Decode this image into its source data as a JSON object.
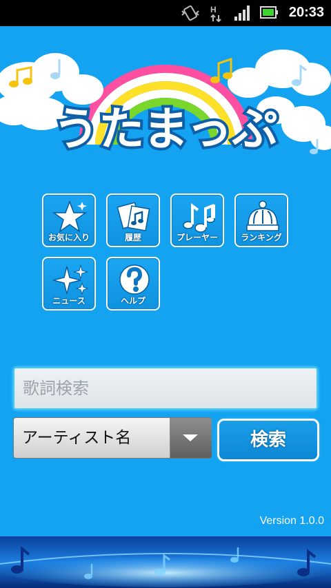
{
  "status_bar": {
    "time": "20:33",
    "icons": [
      "vibrate-icon",
      "hspa-icon",
      "signal-icon",
      "battery-icon"
    ]
  },
  "app": {
    "logo_text": "うたまっぷ"
  },
  "menu": [
    {
      "id": "favorites",
      "label": "お気に入り",
      "icon": "star-icon"
    },
    {
      "id": "history",
      "label": "履歴",
      "icon": "history-icon"
    },
    {
      "id": "player",
      "label": "プレーヤー",
      "icon": "music-notes-icon"
    },
    {
      "id": "ranking",
      "label": "ランキング",
      "icon": "crown-icon"
    },
    {
      "id": "news",
      "label": "ニュース",
      "icon": "sparkle-icon"
    },
    {
      "id": "help",
      "label": "ヘルプ",
      "icon": "help-icon"
    }
  ],
  "search": {
    "placeholder": "歌詞検索",
    "value": "",
    "type_select": "アーティスト名",
    "button_label": "検索"
  },
  "version": "Version 1.0.0",
  "colors": {
    "background": "#13a3f0",
    "accent": "#ffffff"
  }
}
